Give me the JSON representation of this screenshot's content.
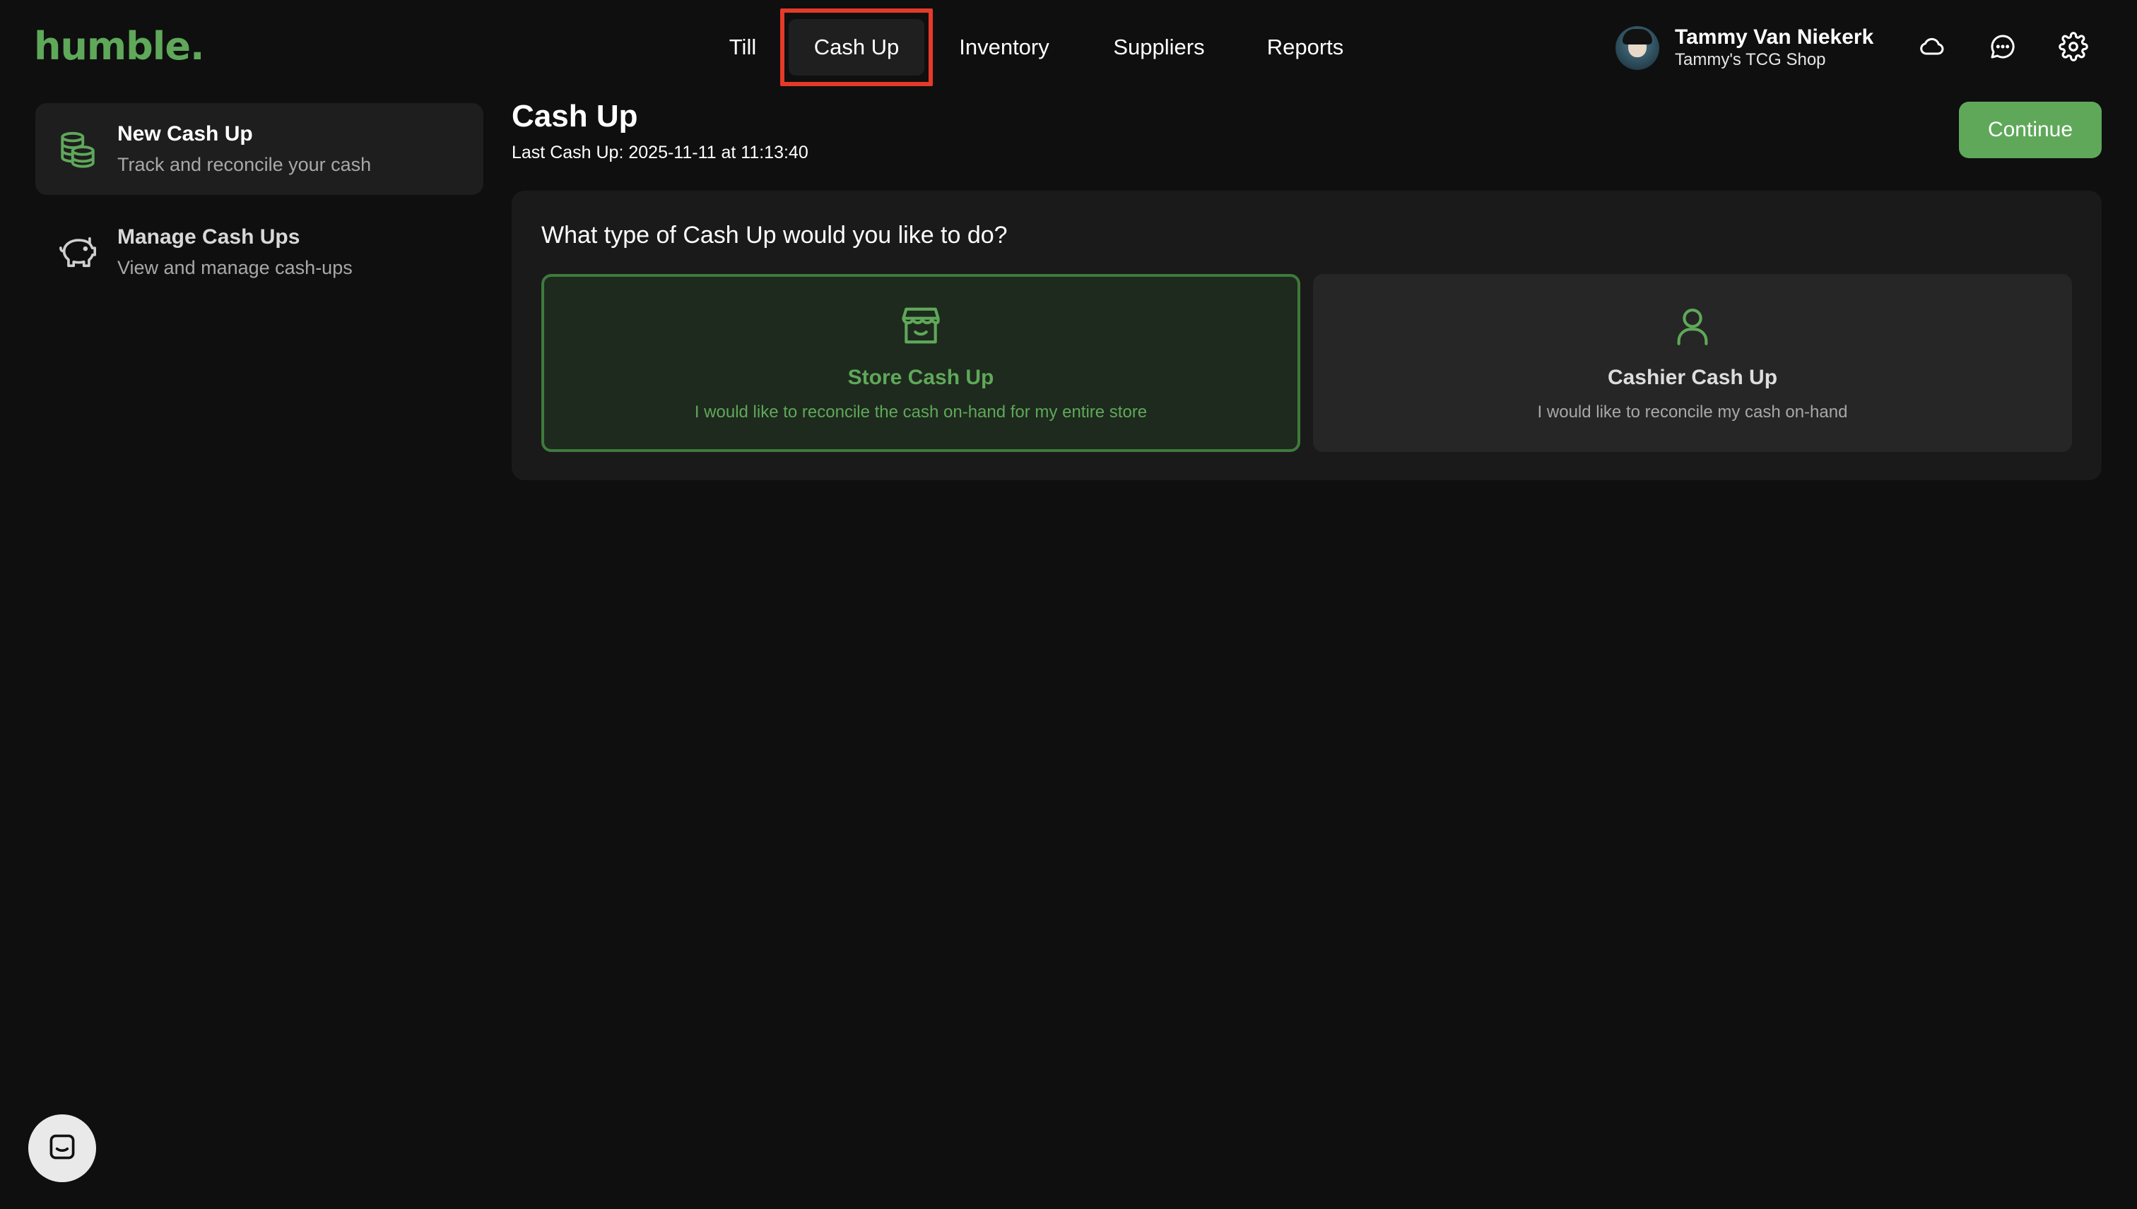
{
  "brand": {
    "logo": "humble."
  },
  "nav": {
    "items": [
      {
        "label": "Till"
      },
      {
        "label": "Cash Up"
      },
      {
        "label": "Inventory"
      },
      {
        "label": "Suppliers"
      },
      {
        "label": "Reports"
      }
    ],
    "active": "Cash Up"
  },
  "user": {
    "name": "Tammy Van Niekerk",
    "shop": "Tammy's TCG Shop"
  },
  "header_icons": [
    "cloud-icon",
    "chat-icon",
    "settings-gear-icon"
  ],
  "sidebar": {
    "items": [
      {
        "title": "New Cash Up",
        "subtitle": "Track and reconcile your cash",
        "icon": "cash-stack-icon",
        "selected": true
      },
      {
        "title": "Manage Cash Ups",
        "subtitle": "View and manage cash-ups",
        "icon": "piggy-bank-icon",
        "selected": false
      }
    ]
  },
  "main": {
    "title": "Cash Up",
    "last_cashup": "Last Cash Up: 2025-11-11 at 11:13:40",
    "continue_label": "Continue",
    "question": "What type of Cash Up would you like to do?",
    "options": [
      {
        "title": "Store Cash Up",
        "subtitle": "I would like to reconcile the cash on-hand for my entire store",
        "icon": "store-icon",
        "selected": true
      },
      {
        "title": "Cashier Cash Up",
        "subtitle": "I would like to reconcile my cash on-hand",
        "icon": "person-icon",
        "selected": false
      }
    ]
  },
  "colors": {
    "accent": "#5fa85a",
    "background": "#0f0f0f",
    "panel": "#1a1a1a",
    "highlight": "#e53a2a"
  }
}
